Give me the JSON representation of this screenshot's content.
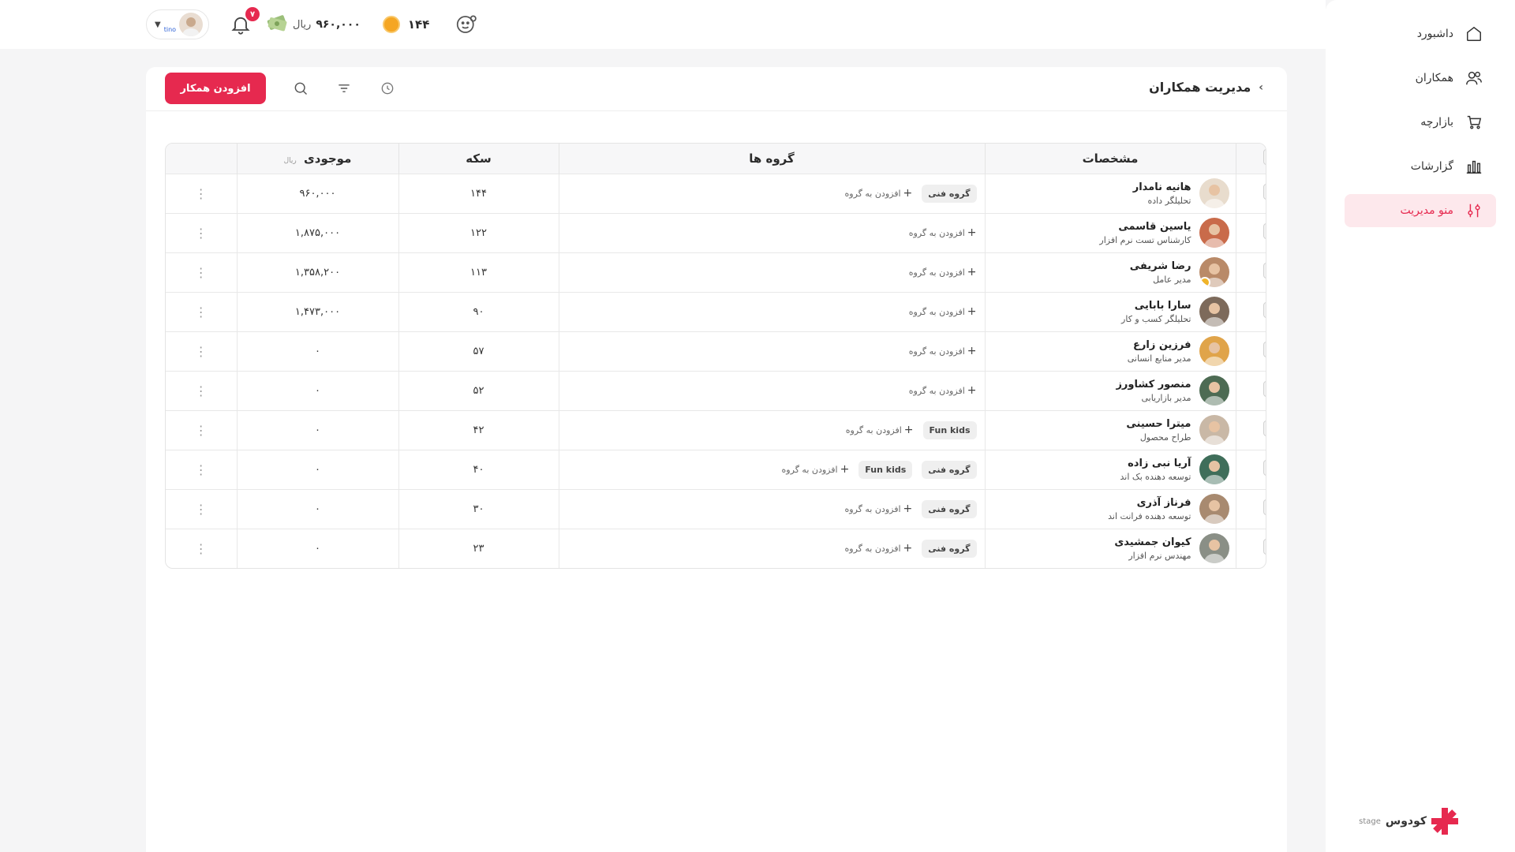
{
  "sidebar": {
    "items": [
      {
        "label": "داشبورد",
        "icon": "home-icon",
        "active": false
      },
      {
        "label": "همکاران",
        "icon": "users-icon",
        "active": false
      },
      {
        "label": "بازارچه",
        "icon": "cart-icon",
        "active": false
      },
      {
        "label": "گزارشات",
        "icon": "bar-chart-icon",
        "active": false
      },
      {
        "label": "منو مدیریت",
        "icon": "settings-sliders-icon",
        "active": true
      }
    ],
    "brand": "کودوس",
    "env": "stage"
  },
  "header": {
    "user_name": "tino",
    "notification_count": "۷",
    "wallet_amount": "۹۶۰,۰۰۰",
    "wallet_unit": "ریال",
    "coins": "۱۴۴"
  },
  "page": {
    "title": "مدیریت همکاران",
    "add_button": "افزودن همکار"
  },
  "table": {
    "headers": {
      "specs": "مشخصات",
      "groups": "گروه ها",
      "coin": "سکه",
      "balance": "موجودی",
      "balance_unit": "ریال"
    },
    "add_group_label": "افزودن به گروه",
    "rows": [
      {
        "name": "هانیه نامدار",
        "role": "تحلیلگر داده",
        "groups": [
          "گروه فنی"
        ],
        "coins": "۱۴۴",
        "balance": "۹۶۰,۰۰۰",
        "verified": false,
        "avatar_bg": "#e8dccd"
      },
      {
        "name": "یاسین قاسمی",
        "role": "کارشناس تست نرم افزار",
        "groups": [],
        "coins": "۱۲۲",
        "balance": "۱,۸۷۵,۰۰۰",
        "verified": false,
        "avatar_bg": "#c96b4a"
      },
      {
        "name": "رضا شریفی",
        "role": "مدیر عامل",
        "groups": [],
        "coins": "۱۱۳",
        "balance": "۱,۳۵۸,۲۰۰",
        "verified": true,
        "avatar_bg": "#b98a68"
      },
      {
        "name": "سارا بابایی",
        "role": "تحلیلگر کسب و کار",
        "groups": [],
        "coins": "۹۰",
        "balance": "۱,۴۷۳,۰۰۰",
        "verified": false,
        "avatar_bg": "#7d6a5b"
      },
      {
        "name": "فرزین زارع",
        "role": "مدیر منابع انسانی",
        "groups": [],
        "coins": "۵۷",
        "balance": "۰",
        "verified": false,
        "avatar_bg": "#e0a44a"
      },
      {
        "name": "منصور کشاورز",
        "role": "مدیر بازاریابی",
        "groups": [],
        "coins": "۵۲",
        "balance": "۰",
        "verified": false,
        "avatar_bg": "#4d6b53"
      },
      {
        "name": "میترا حسینی",
        "role": "طراح محصول",
        "groups": [
          "Fun kids"
        ],
        "coins": "۴۲",
        "balance": "۰",
        "verified": false,
        "avatar_bg": "#c9b8a6"
      },
      {
        "name": "آریا نبی زاده",
        "role": "توسعه دهنده بک اند",
        "groups": [
          "گروه فنی",
          "Fun kids"
        ],
        "coins": "۴۰",
        "balance": "۰",
        "verified": false,
        "avatar_bg": "#3f6e5a"
      },
      {
        "name": "فرناز آذری",
        "role": "توسعه دهنده فرانت اند",
        "groups": [
          "گروه فنی"
        ],
        "coins": "۳۰",
        "balance": "۰",
        "verified": false,
        "avatar_bg": "#a88a70"
      },
      {
        "name": "کیوان جمشیدی",
        "role": "مهندس نرم افزار",
        "groups": [
          "گروه فنی"
        ],
        "coins": "۲۳",
        "balance": "۰",
        "verified": false,
        "avatar_bg": "#8a8f86"
      }
    ]
  }
}
